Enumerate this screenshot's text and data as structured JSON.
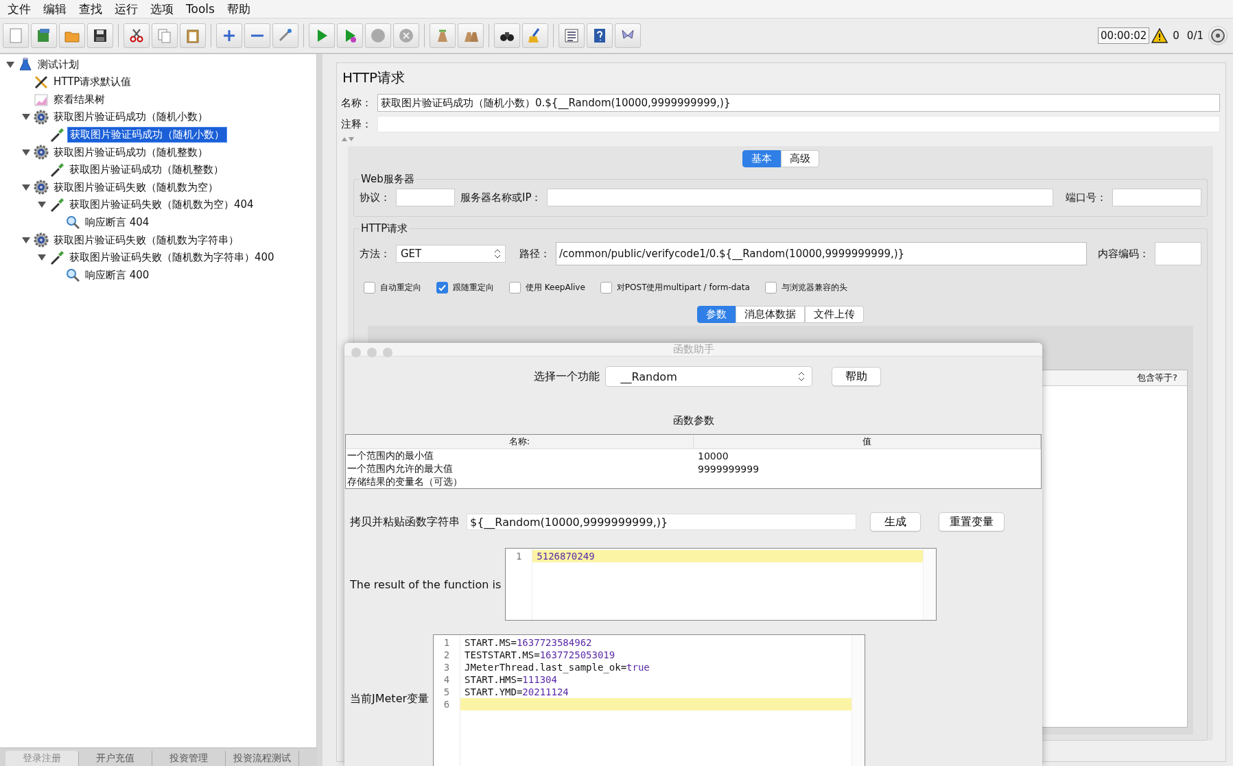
{
  "menu": [
    "文件",
    "编辑",
    "查找",
    "运行",
    "选项",
    "Tools",
    "帮助"
  ],
  "toolbar": {
    "timer": "00:00:02",
    "warnings": "0",
    "threads": "0/1"
  },
  "tree": [
    {
      "label": "测试计划",
      "kind": "plan",
      "expanded": true,
      "selected": false,
      "children": [
        {
          "label": "HTTP请求默认值",
          "kind": "config",
          "expanded": false,
          "selected": false
        },
        {
          "label": "察看结果树",
          "kind": "listener",
          "expanded": false,
          "selected": false
        },
        {
          "label": "获取图片验证码成功（随机小数）",
          "kind": "thread-group",
          "expanded": true,
          "selected": false,
          "children": [
            {
              "label": "获取图片验证码成功（随机小数）",
              "kind": "sampler",
              "expanded": false,
              "selected": true
            }
          ]
        },
        {
          "label": "获取图片验证码成功（随机整数）",
          "kind": "thread-group",
          "expanded": true,
          "selected": false,
          "children": [
            {
              "label": "获取图片验证码成功（随机整数）",
              "kind": "sampler",
              "expanded": false,
              "selected": false
            }
          ]
        },
        {
          "label": "获取图片验证码失败（随机数为空）",
          "kind": "thread-group",
          "expanded": true,
          "selected": false,
          "children": [
            {
              "label": "获取图片验证码失败（随机数为空）404",
              "kind": "sampler",
              "expanded": true,
              "selected": false,
              "children": [
                {
                  "label": "响应断言 404",
                  "kind": "assertion",
                  "expanded": false,
                  "selected": false
                }
              ]
            }
          ]
        },
        {
          "label": "获取图片验证码失败（随机数为字符串）",
          "kind": "thread-group",
          "expanded": true,
          "selected": false,
          "children": [
            {
              "label": "获取图片验证码失败（随机数为字符串）400",
              "kind": "sampler",
              "expanded": true,
              "selected": false,
              "children": [
                {
                  "label": "响应断言 400",
                  "kind": "assertion",
                  "expanded": false,
                  "selected": false
                }
              ]
            }
          ]
        }
      ]
    }
  ],
  "bottom_tabs": [
    {
      "label": "登录注册",
      "selected": true
    },
    {
      "label": "开户充值",
      "selected": false
    },
    {
      "label": "投资管理",
      "selected": false
    },
    {
      "label": "投资流程测试",
      "selected": false
    }
  ],
  "http_form": {
    "title": "HTTP请求",
    "name_label": "名称：",
    "name_value": "获取图片验证码成功（随机小数）0.${__Random(10000,9999999999,)}",
    "comment_label": "注释：",
    "tabs": [
      {
        "label": "基本",
        "selected": true
      },
      {
        "label": "高级",
        "selected": false
      }
    ],
    "web_server": {
      "title": "Web服务器",
      "fields": [
        {
          "label": "协议："
        },
        {
          "label": "服务器名称或IP："
        },
        {
          "label": "端口号："
        }
      ]
    },
    "http_request": {
      "title": "HTTP请求",
      "method_label": "方法：",
      "method": "GET",
      "path_label": "路径：",
      "path": "/common/public/verifycode1/0.${__Random(10000,9999999999,)}",
      "encoding_label": "内容编码：",
      "options": [
        {
          "label": "自动重定向",
          "checked": false
        },
        {
          "label": "跟随重定向",
          "checked": true
        },
        {
          "label": "使用 KeepAlive",
          "checked": false
        },
        {
          "label": "对POST使用multipart / form-data",
          "checked": false
        },
        {
          "label": "与浏览器兼容的头",
          "checked": false
        }
      ],
      "tabs": [
        {
          "label": "参数",
          "selected": true
        },
        {
          "label": "消息体数据",
          "selected": false
        },
        {
          "label": "文件上传",
          "selected": false
        }
      ],
      "params_columns": [
        "包含等于?"
      ]
    }
  },
  "dialog": {
    "title": "函数助手",
    "function_label": "选择一个功能",
    "function": "__Random",
    "help_button": "帮助",
    "params_title": "函数参数",
    "columns": [
      "名称:",
      "值"
    ],
    "rows": [
      {
        "name": "一个范围内的最小值",
        "value": "10000"
      },
      {
        "name": "一个范围内允许的最大值",
        "value": "9999999999"
      },
      {
        "name": "存储结果的变量名（可选）"
      }
    ],
    "copy_label": "拷贝并粘贴函数字符串",
    "function_string": "${__Random(10000,9999999999,)}",
    "generate_button": "生成",
    "reset_button": "重置变量",
    "result_label": "The result of the function is",
    "result_lines": [
      {
        "number": "1",
        "text": "5126870249",
        "highlighted": true
      }
    ],
    "variables_label": "当前JMeter变量",
    "variable_lines": [
      {
        "number": "1",
        "key": "START.MS=",
        "value": "1637723584962",
        "highlighted": false
      },
      {
        "number": "2",
        "key": "TESTSTART.MS=",
        "value": "1637725053019",
        "highlighted": false
      },
      {
        "number": "3",
        "key": "JMeterThread.last_sample_ok=",
        "value": "true",
        "highlighted": false
      },
      {
        "number": "4",
        "key": "START.HMS=",
        "value": "111304",
        "highlighted": false
      },
      {
        "number": "5",
        "key": "START.YMD=",
        "value": "20211124",
        "highlighted": false
      },
      {
        "number": "6",
        "highlighted": true
      }
    ]
  }
}
